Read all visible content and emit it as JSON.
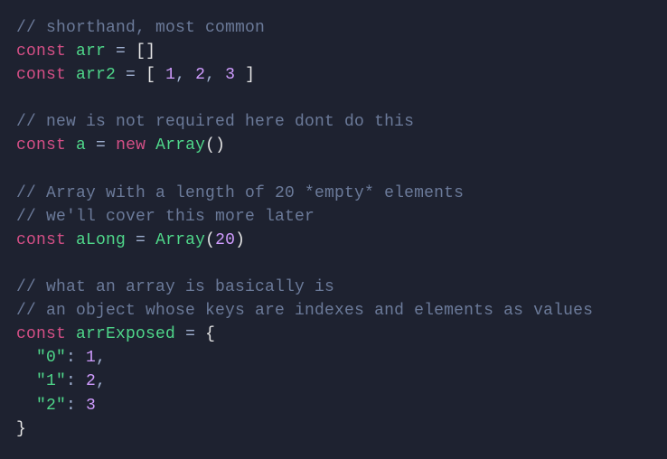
{
  "lines": [
    {
      "type": "comment",
      "text": "// shorthand, most common"
    },
    {
      "type": "code",
      "tokens": [
        {
          "cls": "keyword",
          "t": "const"
        },
        {
          "cls": "op",
          "t": " "
        },
        {
          "cls": "ident",
          "t": "arr"
        },
        {
          "cls": "op",
          "t": " = "
        },
        {
          "cls": "punct",
          "t": "[]"
        }
      ]
    },
    {
      "type": "code",
      "tokens": [
        {
          "cls": "keyword",
          "t": "const"
        },
        {
          "cls": "op",
          "t": " "
        },
        {
          "cls": "ident",
          "t": "arr2"
        },
        {
          "cls": "op",
          "t": " = "
        },
        {
          "cls": "punct",
          "t": "[ "
        },
        {
          "cls": "num",
          "t": "1"
        },
        {
          "cls": "op",
          "t": ", "
        },
        {
          "cls": "num",
          "t": "2"
        },
        {
          "cls": "op",
          "t": ", "
        },
        {
          "cls": "num",
          "t": "3"
        },
        {
          "cls": "punct",
          "t": " ]"
        }
      ]
    },
    {
      "type": "blank"
    },
    {
      "type": "comment",
      "text": "// new is not required here dont do this"
    },
    {
      "type": "code",
      "tokens": [
        {
          "cls": "keyword",
          "t": "const"
        },
        {
          "cls": "op",
          "t": " "
        },
        {
          "cls": "ident",
          "t": "a"
        },
        {
          "cls": "op",
          "t": " = "
        },
        {
          "cls": "keyword",
          "t": "new"
        },
        {
          "cls": "op",
          "t": " "
        },
        {
          "cls": "ident",
          "t": "Array"
        },
        {
          "cls": "punct",
          "t": "()"
        }
      ]
    },
    {
      "type": "blank"
    },
    {
      "type": "comment",
      "text": "// Array with a length of 20 *empty* elements"
    },
    {
      "type": "comment",
      "text": "// we'll cover this more later"
    },
    {
      "type": "code",
      "tokens": [
        {
          "cls": "keyword",
          "t": "const"
        },
        {
          "cls": "op",
          "t": " "
        },
        {
          "cls": "ident",
          "t": "aLong"
        },
        {
          "cls": "op",
          "t": " = "
        },
        {
          "cls": "ident",
          "t": "Array"
        },
        {
          "cls": "punct",
          "t": "("
        },
        {
          "cls": "num",
          "t": "20"
        },
        {
          "cls": "punct",
          "t": ")"
        }
      ]
    },
    {
      "type": "blank"
    },
    {
      "type": "comment",
      "text": "// what an array is basically is"
    },
    {
      "type": "comment",
      "text": "// an object whose keys are indexes and elements as values"
    },
    {
      "type": "code",
      "tokens": [
        {
          "cls": "keyword",
          "t": "const"
        },
        {
          "cls": "op",
          "t": " "
        },
        {
          "cls": "ident",
          "t": "arrExposed"
        },
        {
          "cls": "op",
          "t": " = "
        },
        {
          "cls": "punct",
          "t": "{"
        }
      ]
    },
    {
      "type": "code",
      "tokens": [
        {
          "cls": "op",
          "t": "  "
        },
        {
          "cls": "str",
          "t": "\"0\""
        },
        {
          "cls": "op",
          "t": ": "
        },
        {
          "cls": "num",
          "t": "1"
        },
        {
          "cls": "op",
          "t": ","
        }
      ]
    },
    {
      "type": "code",
      "tokens": [
        {
          "cls": "op",
          "t": "  "
        },
        {
          "cls": "str",
          "t": "\"1\""
        },
        {
          "cls": "op",
          "t": ": "
        },
        {
          "cls": "num",
          "t": "2"
        },
        {
          "cls": "op",
          "t": ","
        }
      ]
    },
    {
      "type": "code",
      "tokens": [
        {
          "cls": "op",
          "t": "  "
        },
        {
          "cls": "str",
          "t": "\"2\""
        },
        {
          "cls": "op",
          "t": ": "
        },
        {
          "cls": "num",
          "t": "3"
        }
      ]
    },
    {
      "type": "code",
      "tokens": [
        {
          "cls": "punct",
          "t": "}"
        }
      ]
    }
  ]
}
